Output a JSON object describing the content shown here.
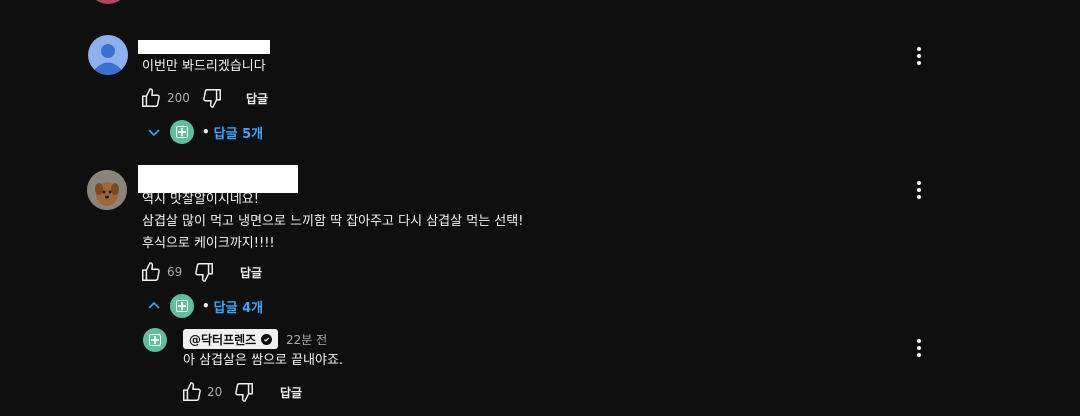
{
  "colors": {
    "background": "#0f0f0f",
    "link": "#3ea6ff",
    "text": "#f1f1f1",
    "muted": "#aaaaaa",
    "channel_avatar": "#5fbf9f"
  },
  "icons": {
    "like": "thumbs-up-icon",
    "dislike": "thumbs-down-icon",
    "more": "more-vert-icon",
    "expand": "chevron-down-icon",
    "collapse": "chevron-up-icon"
  },
  "comments": [
    {
      "text": "이번만 봐드리겠습니다",
      "likes": "200",
      "reply_label": "답글",
      "replies_toggle": "답글 5개"
    },
    {
      "text": "역시 맛잘알이시네요!\n삼겹살 많이 먹고 냉면으로 느끼함 딱 잡아주고 다시 삼겹살 먹는 선택!\n후식으로 케이크까지!!!!",
      "likes": "69",
      "reply_label": "답글",
      "replies_toggle": "답글 4개"
    }
  ],
  "reply": {
    "author": "@닥터프렌즈",
    "time": "22분 전",
    "text": "아 삼겹살은 쌈으로 끝내야죠.",
    "likes": "20",
    "reply_label": "답글"
  }
}
